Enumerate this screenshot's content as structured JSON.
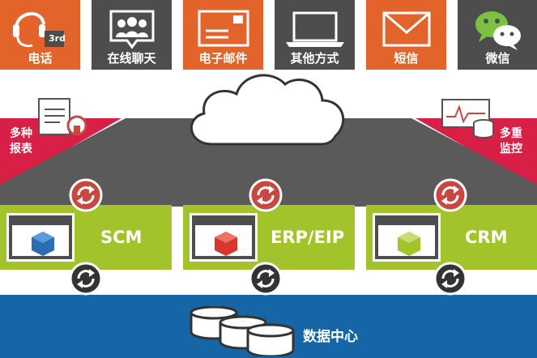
{
  "channels": [
    {
      "label": "电话",
      "icon": "headset-icon",
      "color": "#e2642a",
      "badge": "3rd"
    },
    {
      "label": "在线聊天",
      "icon": "people-chat-icon",
      "color": "#4d4d4d"
    },
    {
      "label": "电子邮件",
      "icon": "envelope-icon",
      "color": "#e2642a"
    },
    {
      "label": "其他方式",
      "icon": "laptop-icon",
      "color": "#4d4d4d"
    },
    {
      "label": "短信",
      "icon": "mail-icon",
      "color": "#e2642a"
    },
    {
      "label": "微信",
      "icon": "wechat-icon",
      "color": "#4d4d4d"
    }
  ],
  "left_corner": {
    "line1": "多种",
    "line2": "报表"
  },
  "right_corner": {
    "line1": "多重",
    "line2": "监控"
  },
  "systems": [
    {
      "name": "SCM",
      "cube_color": "#2a6db5"
    },
    {
      "name": "ERP/EIP",
      "cube_color": "#d9372b"
    },
    {
      "name": "CRM",
      "cube_color": "#a2c42a"
    }
  ],
  "database": {
    "label": "数据中心"
  },
  "colors": {
    "orange": "#e2642a",
    "dark_gray": "#4d4d4d",
    "crimson": "#d81f45",
    "green": "#a2c42a",
    "blue": "#1565a7",
    "sync_red": "#c9473f",
    "sync_dark": "#333333"
  }
}
